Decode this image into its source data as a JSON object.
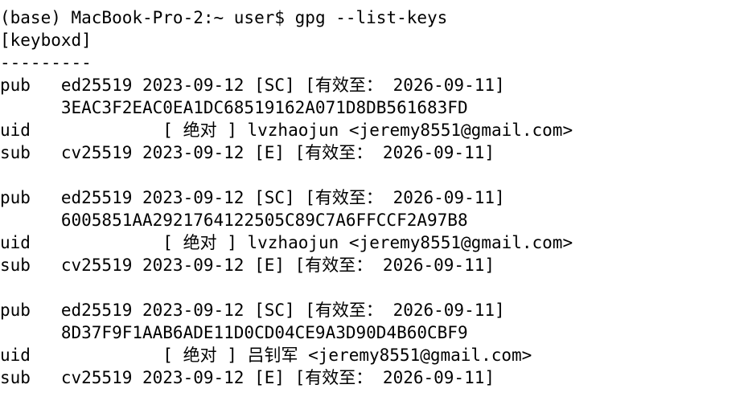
{
  "terminal": {
    "prompt": "(base) MacBook-Pro-2:~ user$ ",
    "command": "gpg --list-keys",
    "lines": [
      "[keyboxd]",
      "---------",
      "pub   ed25519 2023-09-12 [SC] [有效至： 2026-09-11]",
      "      3EAC3F2EAC0EA1DC68519162A071D8DB561683FD",
      "uid             [ 绝对 ] lvzhaojun <jeremy8551@gmail.com>",
      "sub   cv25519 2023-09-12 [E] [有效至： 2026-09-11]",
      "",
      "pub   ed25519 2023-09-12 [SC] [有效至： 2026-09-11]",
      "      6005851AA2921764122505C89C7A6FFCCF2A97B8",
      "uid             [ 绝对 ] lvzhaojun <jeremy8551@gmail.com>",
      "sub   cv25519 2023-09-12 [E] [有效至： 2026-09-11]",
      "",
      "pub   ed25519 2023-09-12 [SC] [有效至： 2026-09-11]",
      "      8D37F9F1AAB6ADE11D0CD04CE9A3D90D4B60CBF9",
      "uid             [ 绝对 ] 吕钊军 <jeremy8551@gmail.com>",
      "sub   cv25519 2023-09-12 [E] [有效至： 2026-09-11]"
    ]
  }
}
